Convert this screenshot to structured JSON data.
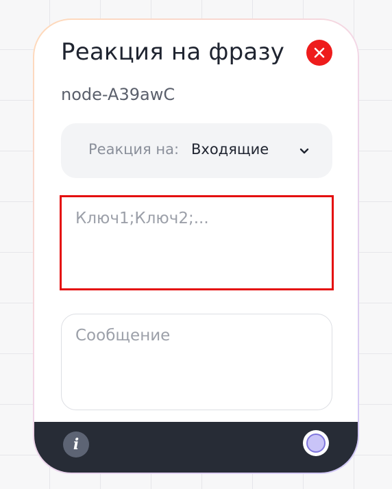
{
  "node": {
    "title": "Реакция на фразу",
    "id_label": "node-A39awC"
  },
  "reaction": {
    "label": "Реакция на:",
    "selected": "Входящие"
  },
  "keys_input": {
    "placeholder": "Ключ1;Ключ2;...",
    "value": ""
  },
  "message_input": {
    "placeholder": "Сообщение",
    "value": ""
  },
  "footer": {
    "info_glyph": "i"
  },
  "icons": {
    "close": "close-icon",
    "chevron": "chevron-down-icon",
    "info": "info-icon",
    "handle": "connection-handle-icon"
  },
  "colors": {
    "close_button": "#ee1c1c",
    "highlight_border": "#e40b0b",
    "footer_bg": "#272c36",
    "handle_fill": "#c9c4f8",
    "handle_ring": "#7f76dc"
  }
}
